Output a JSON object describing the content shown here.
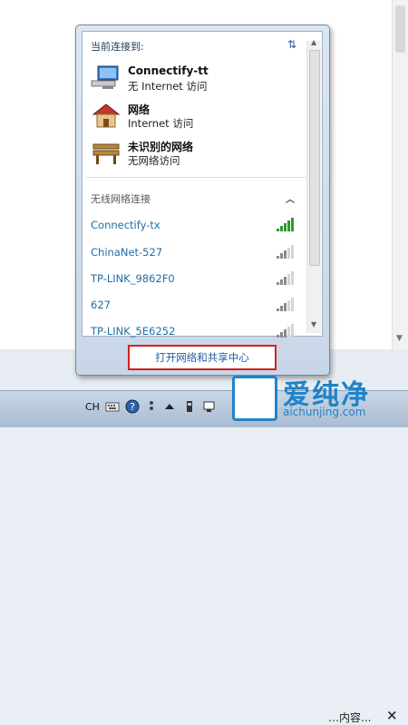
{
  "popup": {
    "current_title": "当前连接到:",
    "connections": [
      {
        "name": "Connectify-tt",
        "status": "无 Internet 访问",
        "icon": "computer-network-icon"
      },
      {
        "name": "网络",
        "status": "Internet 访问",
        "icon": "house-network-icon"
      },
      {
        "name": "未识别的网络",
        "status": "无网络访问",
        "icon": "bench-network-icon"
      }
    ],
    "wireless_header": "无线网络连接",
    "networks": [
      {
        "name": "Connectify-tx",
        "signal_bars": 5,
        "color": "#2e9a2e"
      },
      {
        "name": "ChinaNet-527",
        "signal_bars": 3
      },
      {
        "name": "TP-LINK_9862F0",
        "signal_bars": 3
      },
      {
        "name": "627",
        "signal_bars": 3
      },
      {
        "name": "TP-LINK_5E6252",
        "signal_bars": 3
      }
    ],
    "open_center_label": "打开网络和共享中心"
  },
  "notification": {
    "text": "…内容...",
    "close": "×"
  },
  "taskbar": {
    "lang": "CH"
  },
  "watermark": {
    "cn": "爱纯净",
    "en": "aichunjing.com"
  },
  "colors": {
    "accent": "#1d5fa8",
    "highlight_border": "#d42020",
    "signal_active": "#2e9a2e"
  }
}
